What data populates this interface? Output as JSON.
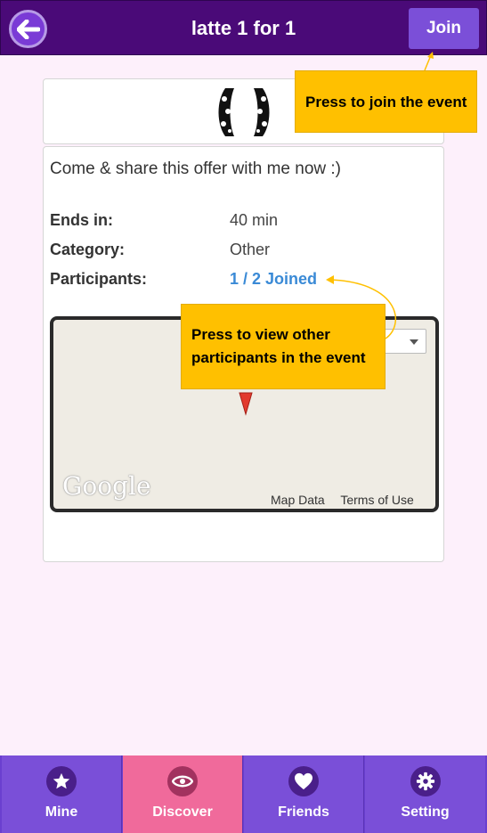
{
  "header": {
    "title": "latte 1 for 1",
    "join_label": "Join"
  },
  "event": {
    "description": "Come & share this offer with me now :)",
    "details": [
      {
        "label": "Ends in:",
        "value": "40 min"
      },
      {
        "label": "Category:",
        "value": "Other"
      },
      {
        "label": "Participants:",
        "value": "1 / 2 Joined"
      }
    ]
  },
  "map": {
    "logo_text": "Google",
    "map_data_label": "Map Data",
    "terms_label": "Terms of Use"
  },
  "callouts": {
    "join": "Press to join the event",
    "participants": "Press to view other participants in the event"
  },
  "nav": {
    "items": [
      {
        "label": "Mine",
        "icon": "star-icon"
      },
      {
        "label": "Discover",
        "icon": "eye-icon"
      },
      {
        "label": "Friends",
        "icon": "heart-icon"
      },
      {
        "label": "Setting",
        "icon": "gear-icon"
      }
    ],
    "active": "Discover"
  },
  "colors": {
    "header": "#4a0a78",
    "accent": "#7b4fd8",
    "active_tab": "#f06a9b",
    "callout": "#ffc000",
    "link": "#3a8ad6"
  }
}
